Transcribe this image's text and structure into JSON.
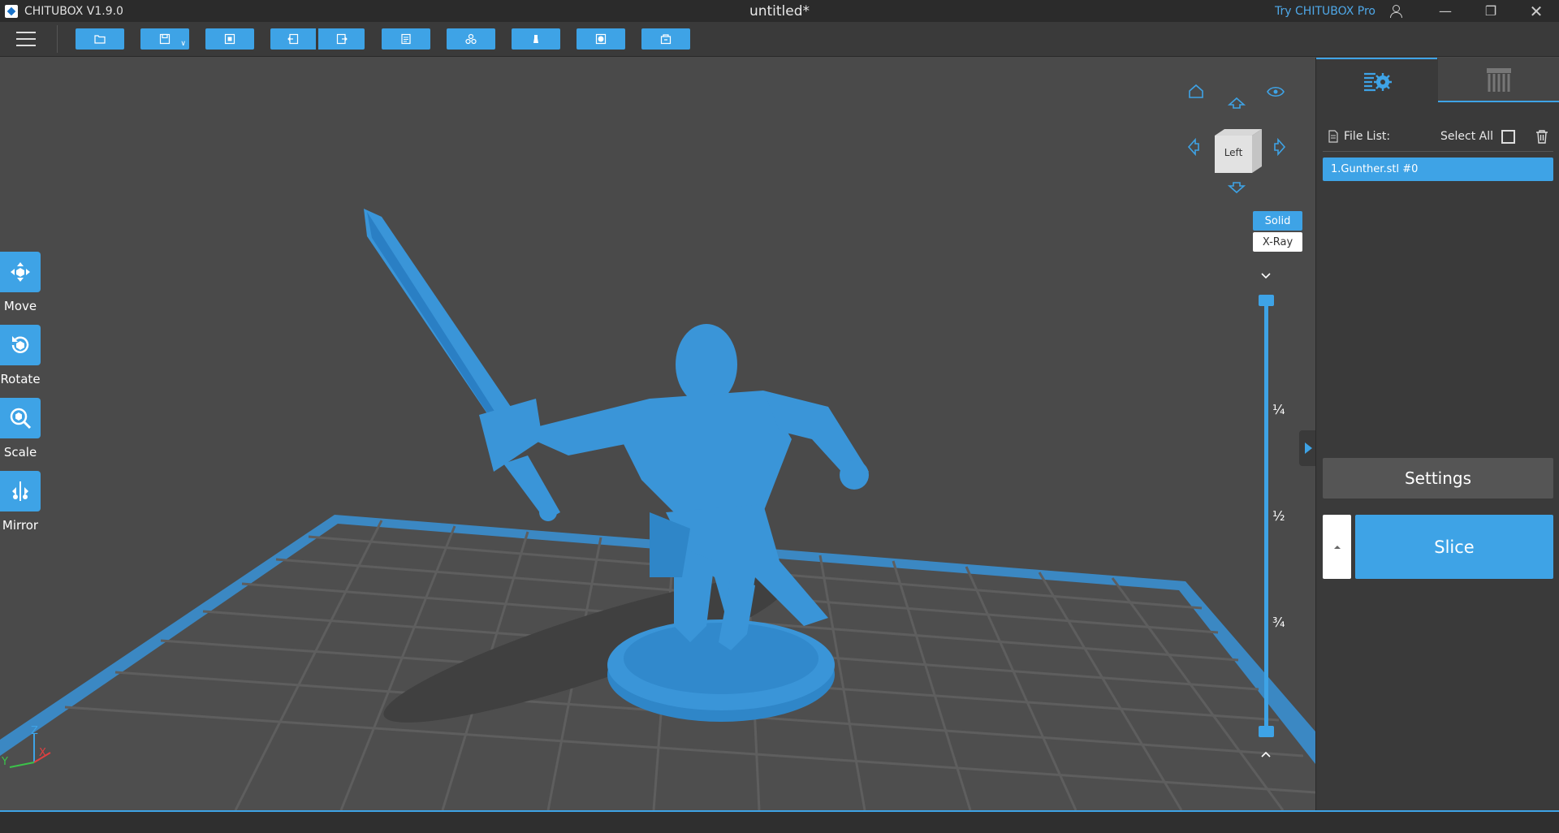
{
  "titlebar": {
    "app_name": "CHITUBOX V1.9.0",
    "document_title": "untitled*",
    "try_pro": "Try CHITUBOX Pro"
  },
  "toolbar": {
    "buttons": [
      "open-file-icon",
      "save-icon",
      "auto-layout-icon",
      "undo-icon",
      "redo-icon",
      "copy-icon",
      "arrange-icon",
      "support-icon",
      "hollow-icon",
      "drill-icon"
    ]
  },
  "tools": [
    {
      "label": "Move",
      "icon": "move-icon"
    },
    {
      "label": "Rotate",
      "icon": "rotate-icon"
    },
    {
      "label": "Scale",
      "icon": "scale-icon"
    },
    {
      "label": "Mirror",
      "icon": "mirror-icon"
    }
  ],
  "view_cube": {
    "face": "Left"
  },
  "render_modes": {
    "solid": "Solid",
    "xray": "X-Ray",
    "active": "Solid"
  },
  "layer_slider": {
    "marks": [
      "¼",
      "½",
      "¾"
    ]
  },
  "axis": {
    "x": "X",
    "y": "Y",
    "z": "Z"
  },
  "right_panel": {
    "file_list_label": "File List:",
    "select_all": "Select All",
    "files": [
      "1.Gunther.stl #0"
    ],
    "settings_label": "Settings",
    "slice_label": "Slice"
  },
  "colors": {
    "accent": "#3ea3e6",
    "model": "#3a95d8",
    "platform_edge": "#3a8fd0"
  }
}
